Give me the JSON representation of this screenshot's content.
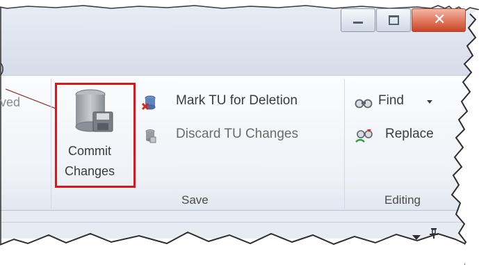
{
  "window_controls": {
    "minimize_icon": "minimize-icon",
    "maximize_icon": "maximize-icon",
    "close_icon": "close-icon"
  },
  "partial_label_left": "ved",
  "callout_marker": ")",
  "save_group": {
    "commit_button": {
      "line1": "Commit",
      "line2": "Changes",
      "icon": "database-save-icon"
    },
    "mark_tu_for_deletion": {
      "label": "Mark TU for Deletion",
      "icon": "database-delete-icon"
    },
    "discard_tu_changes": {
      "label": "Discard TU Changes",
      "icon": "discard-icon"
    },
    "group_label": "Save"
  },
  "editing_group": {
    "find": {
      "label": "Find",
      "icon": "binoculars-icon",
      "dropdown_icon": "dropdown-arrow-icon"
    },
    "replace": {
      "label": "Replace",
      "icon": "replace-icon"
    },
    "group_label": "Editing"
  },
  "bottom_bar": {
    "dropdown_icon": "chevron-down-icon",
    "pin_icon": "pin-icon"
  },
  "colors": {
    "highlight": "#e3131a",
    "ribbon_background": "#f1f4f8",
    "title_background": "#dfe6f0"
  }
}
